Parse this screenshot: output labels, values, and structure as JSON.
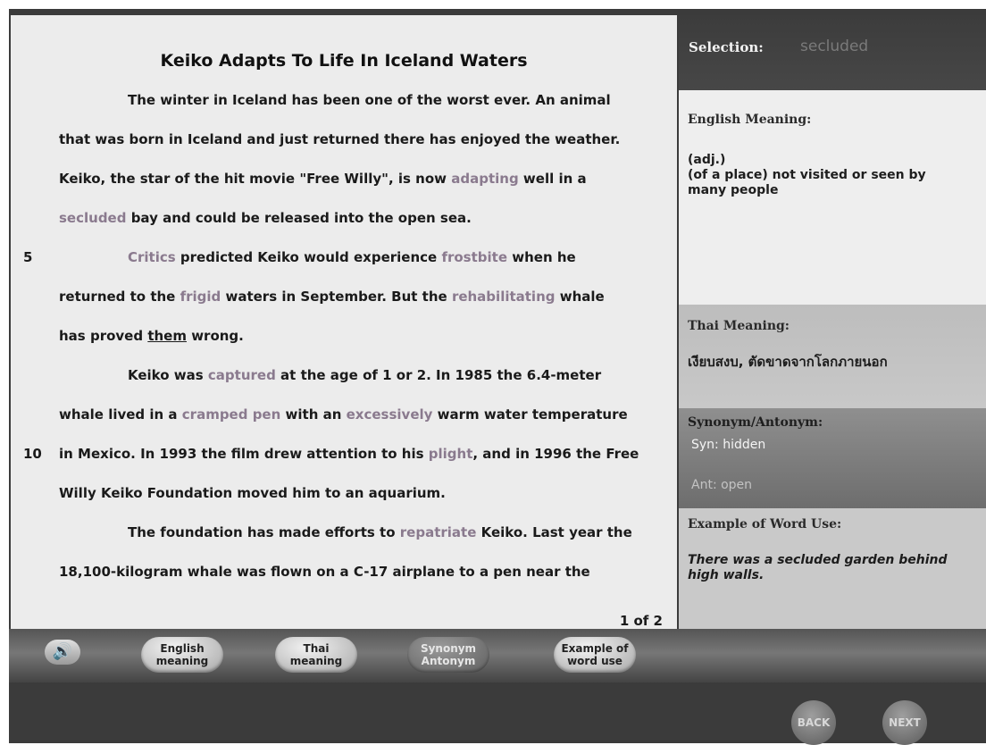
{
  "article": {
    "title": "Keiko Adapts To Life In Iceland Waters",
    "line_number_5": "5",
    "line_number_10": "10",
    "page_indicator": "1 of 2",
    "vocabulary": [
      "adapting",
      "secluded",
      "Critics",
      "frostbite",
      "frigid",
      "rehabilitating",
      "captured",
      "cramped pen",
      "excessively",
      "plight",
      "repatriate"
    ],
    "lines": [
      {
        "segments": [
          {
            "t": "The winter in Iceland has been one of the worst ever.  An animal"
          }
        ]
      },
      {
        "segments": [
          {
            "t": "that was born in Iceland and just returned there has enjoyed the weather."
          }
        ]
      },
      {
        "segments": [
          {
            "t": "Keiko, the star of the hit movie \"Free Willy\", is now "
          },
          {
            "t": "adapting",
            "v": true
          },
          {
            "t": " well in a"
          }
        ]
      },
      {
        "segments": [
          {
            "t": "secluded",
            "v": true
          },
          {
            "t": " bay and could be released into the open sea."
          }
        ]
      },
      {
        "segments": [
          {
            "t": "Critics",
            "v": true
          },
          {
            "t": " predicted Keiko would experience "
          },
          {
            "t": "frostbite",
            "v": true
          },
          {
            "t": " when he"
          }
        ]
      },
      {
        "segments": [
          {
            "t": "returned to the "
          },
          {
            "t": "frigid",
            "v": true
          },
          {
            "t": " waters in September.  But the "
          },
          {
            "t": "rehabilitating",
            "v": true
          },
          {
            "t": " whale"
          }
        ]
      },
      {
        "segments": [
          {
            "t": "has proved "
          },
          {
            "t": "them",
            "u": true
          },
          {
            "t": " wrong."
          }
        ]
      },
      {
        "segments": [
          {
            "t": "Keiko was "
          },
          {
            "t": "captured",
            "v": true
          },
          {
            "t": " at the age of 1 or 2.  In 1985 the 6.4-meter"
          }
        ]
      },
      {
        "segments": [
          {
            "t": "whale lived in a "
          },
          {
            "t": "cramped pen",
            "v": true
          },
          {
            "t": " with an "
          },
          {
            "t": "excessively",
            "v": true
          },
          {
            "t": " warm water temperature"
          }
        ]
      },
      {
        "segments": [
          {
            "t": "in Mexico.  In 1993 the film drew attention to his "
          },
          {
            "t": "plight",
            "v": true
          },
          {
            "t": ", and in 1996 the Free"
          }
        ]
      },
      {
        "segments": [
          {
            "t": "Willy Keiko Foundation moved him to an aquarium."
          }
        ]
      },
      {
        "segments": [
          {
            "t": "The foundation has made efforts to "
          },
          {
            "t": "repatriate",
            "v": true
          },
          {
            "t": " Keiko.  Last year the"
          }
        ]
      },
      {
        "segments": [
          {
            "t": "18,100-kilogram whale was flown on a C-17 airplane to a pen near the"
          }
        ]
      }
    ]
  },
  "sidebar": {
    "selection_label": "Selection:",
    "selection_word": "secluded",
    "english_label": "English Meaning:",
    "english_pos": "(adj.)",
    "english_definition": "(of a place) not visited or seen by many people",
    "thai_label": "Thai Meaning:",
    "thai_text": "เงียบสงบ, ตัดขาดจากโลกภายนอก",
    "synonym_label": "Synonym/Antonym:",
    "synonym": "Syn: hidden",
    "antonym": "Ant: open",
    "example_label": "Example of Word Use:",
    "example_text": "There was a secluded garden behind high walls."
  },
  "toolbar": {
    "speaker_icon": "speaker-icon",
    "buttons": [
      {
        "line1": "English",
        "line2": "meaning"
      },
      {
        "line1": "Thai",
        "line2": "meaning"
      },
      {
        "line1": "Synonym",
        "line2": "Antonym"
      },
      {
        "line1": "Example of",
        "line2": "word use"
      }
    ]
  },
  "nav": {
    "back_label": "BACK",
    "next_label": "NEXT"
  },
  "colors": {
    "vocab_highlight": "#8a7a8e",
    "frame": "#3b3b3b",
    "reading_bg": "#ececec"
  }
}
